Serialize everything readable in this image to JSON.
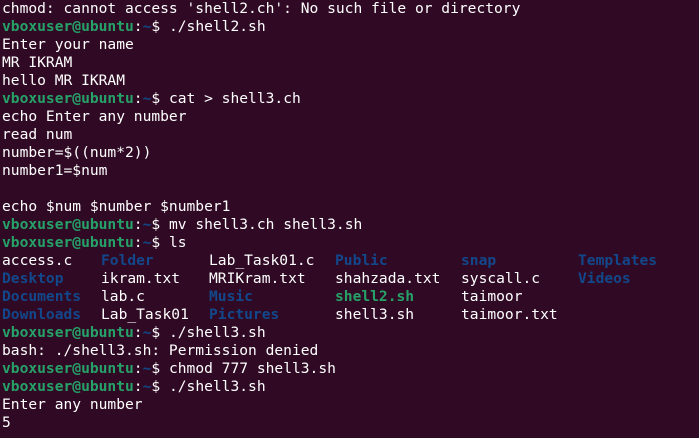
{
  "prompt": {
    "user_host": "vboxuser@ubuntu",
    "colon": ":",
    "path": "~",
    "symbol": "$ "
  },
  "lines": [
    {
      "type": "output",
      "text": "chmod: cannot access 'shell2.ch': No such file or directory"
    },
    {
      "type": "command",
      "text": "./shell2.sh"
    },
    {
      "type": "output",
      "text": "Enter your name"
    },
    {
      "type": "output",
      "text": "MR IKRAM"
    },
    {
      "type": "output",
      "text": "hello MR IKRAM"
    },
    {
      "type": "command",
      "text": "cat > shell3.ch"
    },
    {
      "type": "output",
      "text": "echo Enter any number"
    },
    {
      "type": "output",
      "text": "read num"
    },
    {
      "type": "output",
      "text": "number=$((num*2))"
    },
    {
      "type": "output",
      "text": "number1=$num"
    },
    {
      "type": "output",
      "text": ""
    },
    {
      "type": "output",
      "text": "echo $num $number $number1"
    },
    {
      "type": "command",
      "text": "mv shell3.ch shell3.sh"
    },
    {
      "type": "command",
      "text": "ls"
    }
  ],
  "ls_rows": [
    [
      {
        "name": "access.c",
        "kind": "file"
      },
      {
        "name": "Folder",
        "kind": "dir"
      },
      {
        "name": "Lab_Task01.c",
        "kind": "file"
      },
      {
        "name": "Public",
        "kind": "dir"
      },
      {
        "name": "snap",
        "kind": "dir"
      },
      {
        "name": "Templates",
        "kind": "dir"
      }
    ],
    [
      {
        "name": "Desktop",
        "kind": "dir"
      },
      {
        "name": "ikram.txt",
        "kind": "file"
      },
      {
        "name": "MRIKram.txt",
        "kind": "file"
      },
      {
        "name": "shahzada.txt",
        "kind": "file"
      },
      {
        "name": "syscall.c",
        "kind": "file"
      },
      {
        "name": "Videos",
        "kind": "dir"
      }
    ],
    [
      {
        "name": "Documents",
        "kind": "dir"
      },
      {
        "name": "lab.c",
        "kind": "file"
      },
      {
        "name": "Music",
        "kind": "dir"
      },
      {
        "name": "shell2.sh",
        "kind": "exe"
      },
      {
        "name": "taimoor",
        "kind": "file"
      },
      {
        "name": "",
        "kind": "file"
      }
    ],
    [
      {
        "name": "Downloads",
        "kind": "dir"
      },
      {
        "name": "Lab_Task01",
        "kind": "file"
      },
      {
        "name": "Pictures",
        "kind": "dir"
      },
      {
        "name": "shell3.sh",
        "kind": "file"
      },
      {
        "name": "taimoor.txt",
        "kind": "file"
      },
      {
        "name": "",
        "kind": "file"
      }
    ]
  ],
  "after_lines": [
    {
      "type": "command",
      "text": "./shell3.sh"
    },
    {
      "type": "output",
      "text": "bash: ./shell3.sh: Permission denied"
    },
    {
      "type": "command",
      "text": "chmod 777 shell3.sh"
    },
    {
      "type": "command",
      "text": "./shell3.sh"
    },
    {
      "type": "output",
      "text": "Enter any number"
    },
    {
      "type": "output",
      "text": "5"
    }
  ],
  "colors": {
    "background": "#300a24",
    "text": "#ffffff",
    "user": "#26a269",
    "path": "#12488b",
    "dir": "#12488b",
    "exe": "#26a269"
  }
}
